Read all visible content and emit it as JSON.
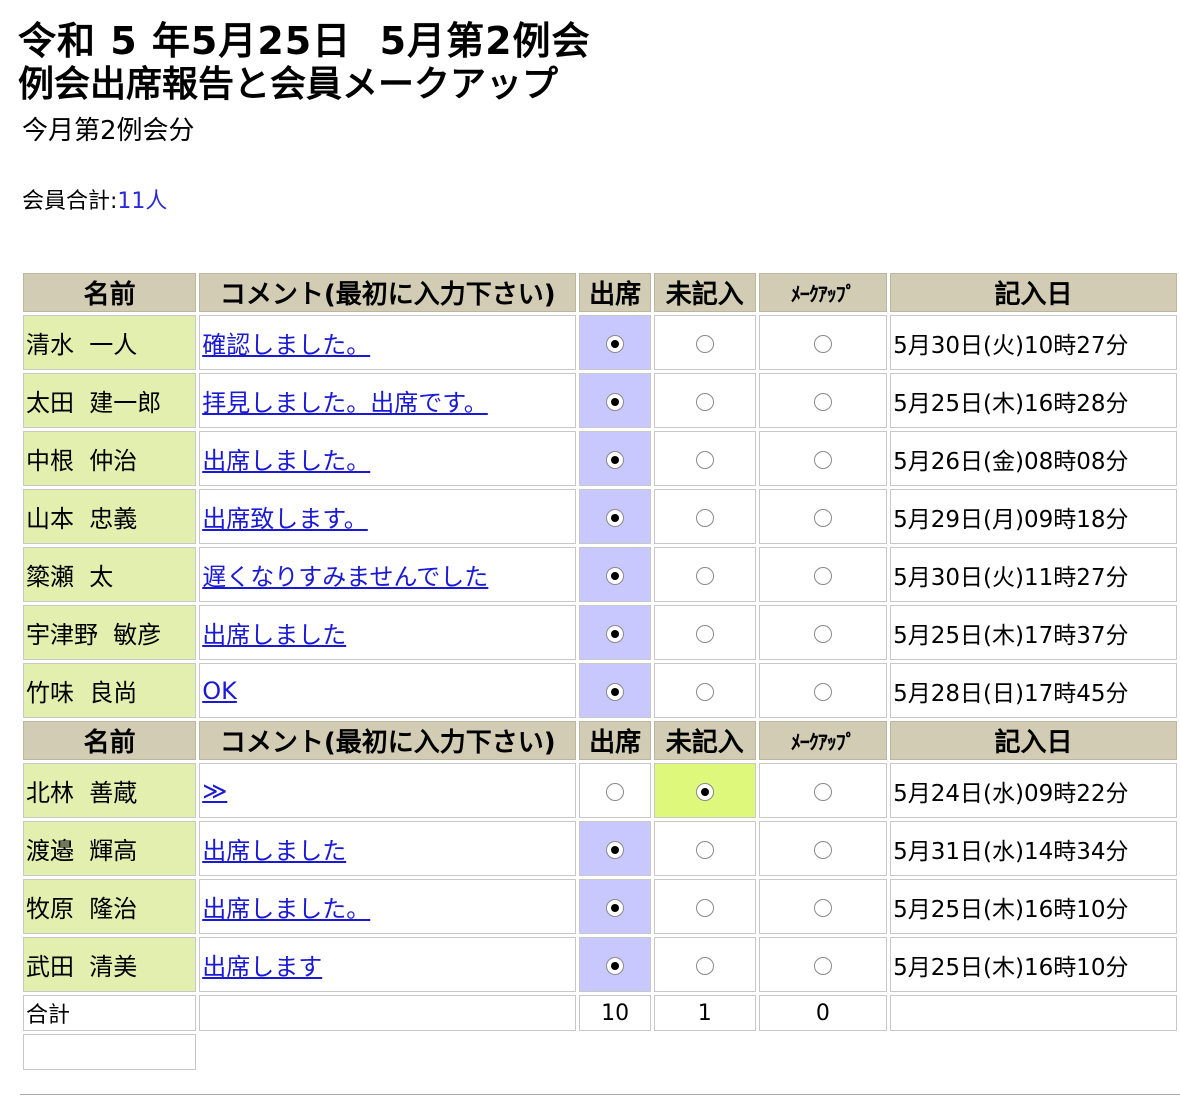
{
  "header": {
    "line1": "令和 5 年5月25日  5月第2例会",
    "line2": "例会出席報告と会員メークアップ",
    "line3": "今月第2例会分"
  },
  "summary": {
    "label": "会員合計:",
    "count": "11人"
  },
  "table": {
    "headers": {
      "name": "名前",
      "comment": "コメント(最初に入力下さい)",
      "attend": "出席",
      "blank": "未記入",
      "makeup": "ﾒｰｸｱｯﾌﾟ",
      "date": "記入日"
    },
    "rows": [
      {
        "name": "清水  一人",
        "comment": "確認しました。",
        "status": "attend",
        "date": "5月30日(火)10時27分"
      },
      {
        "name": "太田  建一郎",
        "comment": "拝見しました。出席です。",
        "status": "attend",
        "date": "5月25日(木)16時28分"
      },
      {
        "name": "中根  仲治",
        "comment": "出席しました。",
        "status": "attend",
        "date": "5月26日(金)08時08分"
      },
      {
        "name": "山本  忠義",
        "comment": "出席致します。",
        "status": "attend",
        "date": "5月29日(月)09時18分"
      },
      {
        "name": "簗瀬  太",
        "comment": "遅くなりすみませんでした",
        "status": "attend",
        "date": "5月30日(火)11時27分"
      },
      {
        "name": "宇津野  敏彦",
        "comment": "出席しました",
        "status": "attend",
        "date": "5月25日(木)17時37分"
      },
      {
        "name": "竹味  良尚",
        "comment": "OK",
        "status": "attend",
        "date": "5月28日(日)17時45分"
      },
      {
        "name": "北林  善蔵",
        "comment": "≫",
        "status": "blank",
        "date": "5月24日(水)09時22分"
      },
      {
        "name": "渡邉  輝高",
        "comment": "出席しました",
        "status": "attend",
        "date": "5月31日(水)14時34分"
      },
      {
        "name": "牧原  隆治",
        "comment": "出席しました。",
        "status": "attend",
        "date": "5月25日(木)16時10分"
      },
      {
        "name": "武田  清美",
        "comment": "出席します",
        "status": "attend",
        "date": "5月25日(木)16時10分"
      }
    ],
    "total": {
      "label": "合計",
      "attend": "10",
      "blank": "1",
      "makeup": "0"
    }
  }
}
